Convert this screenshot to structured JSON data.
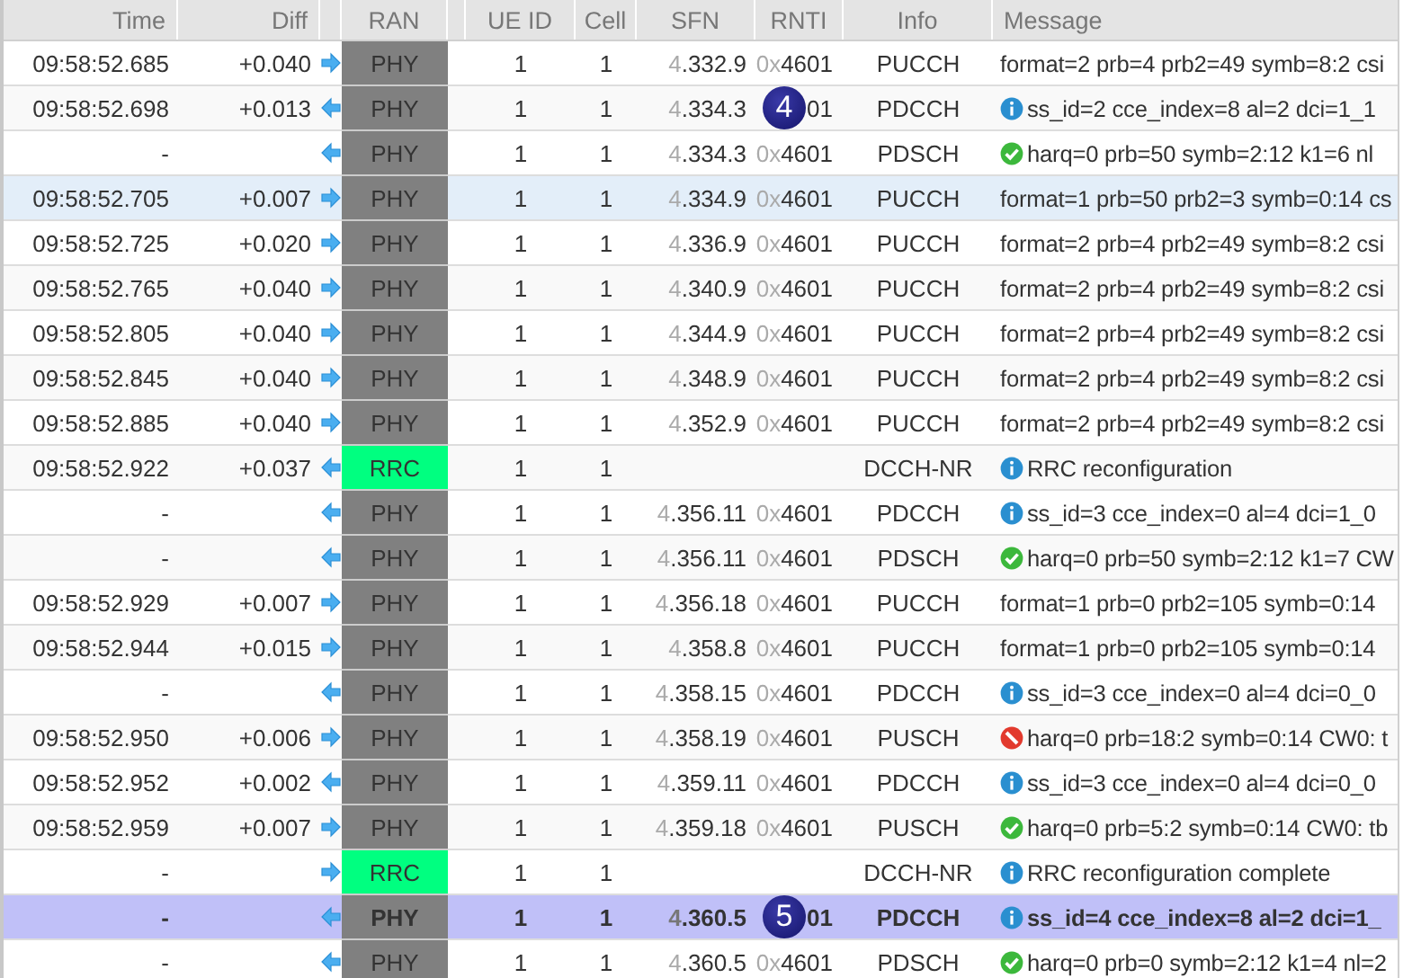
{
  "columns": [
    "Time",
    "Diff",
    "RAN",
    "UE ID",
    "Cell",
    "SFN",
    "RNTI",
    "Info",
    "Message"
  ],
  "rows": [
    {
      "time": "09:58:52.685",
      "diff": "+0.040",
      "arrow": {
        "kind": "right"
      },
      "ran": {
        "text": "PHY",
        "color": "#808080"
      },
      "ue": "1",
      "cell": "1",
      "sfn": {
        "hyper": "4",
        "rest": ".332.9"
      },
      "rnti": {
        "prefix": "0x",
        "value": "4601"
      },
      "info": "PUCCH",
      "message": {
        "kind": "plain",
        "text": "format=2 prb=4 prb2=49 symb=8:2 csi"
      },
      "selected": false,
      "hover": false
    },
    {
      "time": "09:58:52.698",
      "diff": "+0.013",
      "arrow": {
        "kind": "left"
      },
      "ran": {
        "text": "PHY",
        "color": "#808080"
      },
      "ue": "1",
      "cell": "1",
      "sfn": {
        "hyper": "4",
        "rest": ".334.3"
      },
      "rnti": {
        "value": "01"
      },
      "badge": "4",
      "info": "PDCCH",
      "message": {
        "kind": "info",
        "text": "ss_id=2 cce_index=8 al=2 dci=1_1"
      },
      "selected": false,
      "hover": false
    },
    {
      "time": "-",
      "arrow": {
        "kind": "left"
      },
      "ran": {
        "text": "PHY",
        "color": "#808080"
      },
      "ue": "1",
      "cell": "1",
      "sfn": {
        "hyper": "4",
        "rest": ".334.3"
      },
      "rnti": {
        "prefix": "0x",
        "value": "4601"
      },
      "info": "PDSCH",
      "message": {
        "kind": "ok",
        "text": "harq=0 prb=50 symb=2:12 k1=6 nl"
      },
      "selected": false,
      "hover": false
    },
    {
      "time": "09:58:52.705",
      "diff": "+0.007",
      "arrow": {
        "kind": "right"
      },
      "ran": {
        "text": "PHY",
        "color": "#808080"
      },
      "ue": "1",
      "cell": "1",
      "sfn": {
        "hyper": "4",
        "rest": ".334.9"
      },
      "rnti": {
        "prefix": "0x",
        "value": "4601"
      },
      "info": "PUCCH",
      "message": {
        "kind": "plain",
        "text": "format=1 prb=50 prb2=3 symb=0:14 cs"
      },
      "selected": false,
      "hover": true
    },
    {
      "time": "09:58:52.725",
      "diff": "+0.020",
      "arrow": {
        "kind": "right"
      },
      "ran": {
        "text": "PHY",
        "color": "#808080"
      },
      "ue": "1",
      "cell": "1",
      "sfn": {
        "hyper": "4",
        "rest": ".336.9"
      },
      "rnti": {
        "prefix": "0x",
        "value": "4601"
      },
      "info": "PUCCH",
      "message": {
        "kind": "plain",
        "text": "format=2 prb=4 prb2=49 symb=8:2 csi"
      },
      "selected": false,
      "hover": false
    },
    {
      "time": "09:58:52.765",
      "diff": "+0.040",
      "arrow": {
        "kind": "right"
      },
      "ran": {
        "text": "PHY",
        "color": "#808080"
      },
      "ue": "1",
      "cell": "1",
      "sfn": {
        "hyper": "4",
        "rest": ".340.9"
      },
      "rnti": {
        "prefix": "0x",
        "value": "4601"
      },
      "info": "PUCCH",
      "message": {
        "kind": "plain",
        "text": "format=2 prb=4 prb2=49 symb=8:2 csi"
      },
      "selected": false,
      "hover": false
    },
    {
      "time": "09:58:52.805",
      "diff": "+0.040",
      "arrow": {
        "kind": "right"
      },
      "ran": {
        "text": "PHY",
        "color": "#808080"
      },
      "ue": "1",
      "cell": "1",
      "sfn": {
        "hyper": "4",
        "rest": ".344.9"
      },
      "rnti": {
        "prefix": "0x",
        "value": "4601"
      },
      "info": "PUCCH",
      "message": {
        "kind": "plain",
        "text": "format=2 prb=4 prb2=49 symb=8:2 csi"
      },
      "selected": false,
      "hover": false
    },
    {
      "time": "09:58:52.845",
      "diff": "+0.040",
      "arrow": {
        "kind": "right"
      },
      "ran": {
        "text": "PHY",
        "color": "#808080"
      },
      "ue": "1",
      "cell": "1",
      "sfn": {
        "hyper": "4",
        "rest": ".348.9"
      },
      "rnti": {
        "prefix": "0x",
        "value": "4601"
      },
      "info": "PUCCH",
      "message": {
        "kind": "plain",
        "text": "format=2 prb=4 prb2=49 symb=8:2 csi"
      },
      "selected": false,
      "hover": false
    },
    {
      "time": "09:58:52.885",
      "diff": "+0.040",
      "arrow": {
        "kind": "right"
      },
      "ran": {
        "text": "PHY",
        "color": "#808080"
      },
      "ue": "1",
      "cell": "1",
      "sfn": {
        "hyper": "4",
        "rest": ".352.9"
      },
      "rnti": {
        "prefix": "0x",
        "value": "4601"
      },
      "info": "PUCCH",
      "message": {
        "kind": "plain",
        "text": "format=2 prb=4 prb2=49 symb=8:2 csi"
      },
      "selected": false,
      "hover": false
    },
    {
      "time": "09:58:52.922",
      "diff": "+0.037",
      "arrow": {
        "kind": "left"
      },
      "ran": {
        "text": "RRC",
        "color": "#00ff80"
      },
      "ue": "1",
      "cell": "1",
      "info": "DCCH-NR",
      "message": {
        "kind": "info",
        "text": "RRC reconfiguration"
      },
      "selected": false,
      "hover": false
    },
    {
      "time": "-",
      "arrow": {
        "kind": "left"
      },
      "ran": {
        "text": "PHY",
        "color": "#808080"
      },
      "ue": "1",
      "cell": "1",
      "sfn": {
        "hyper": "4",
        "rest": ".356.11"
      },
      "rnti": {
        "prefix": "0x",
        "value": "4601"
      },
      "info": "PDCCH",
      "message": {
        "kind": "info",
        "text": "ss_id=3 cce_index=0 al=4 dci=1_0"
      },
      "selected": false,
      "hover": false
    },
    {
      "time": "-",
      "arrow": {
        "kind": "left"
      },
      "ran": {
        "text": "PHY",
        "color": "#808080"
      },
      "ue": "1",
      "cell": "1",
      "sfn": {
        "hyper": "4",
        "rest": ".356.11"
      },
      "rnti": {
        "prefix": "0x",
        "value": "4601"
      },
      "info": "PDSCH",
      "message": {
        "kind": "ok",
        "text": "harq=0 prb=50 symb=2:12 k1=7 CW"
      },
      "selected": false,
      "hover": false
    },
    {
      "time": "09:58:52.929",
      "diff": "+0.007",
      "arrow": {
        "kind": "right"
      },
      "ran": {
        "text": "PHY",
        "color": "#808080"
      },
      "ue": "1",
      "cell": "1",
      "sfn": {
        "hyper": "4",
        "rest": ".356.18"
      },
      "rnti": {
        "prefix": "0x",
        "value": "4601"
      },
      "info": "PUCCH",
      "message": {
        "kind": "plain",
        "text": "format=1 prb=0 prb2=105 symb=0:14"
      },
      "selected": false,
      "hover": false
    },
    {
      "time": "09:58:52.944",
      "diff": "+0.015",
      "arrow": {
        "kind": "right"
      },
      "ran": {
        "text": "PHY",
        "color": "#808080"
      },
      "ue": "1",
      "cell": "1",
      "sfn": {
        "hyper": "4",
        "rest": ".358.8"
      },
      "rnti": {
        "prefix": "0x",
        "value": "4601"
      },
      "info": "PUCCH",
      "message": {
        "kind": "plain",
        "text": "format=1 prb=0 prb2=105 symb=0:14"
      },
      "selected": false,
      "hover": false
    },
    {
      "time": "-",
      "arrow": {
        "kind": "left"
      },
      "ran": {
        "text": "PHY",
        "color": "#808080"
      },
      "ue": "1",
      "cell": "1",
      "sfn": {
        "hyper": "4",
        "rest": ".358.15"
      },
      "rnti": {
        "prefix": "0x",
        "value": "4601"
      },
      "info": "PDCCH",
      "message": {
        "kind": "info",
        "text": "ss_id=3 cce_index=0 al=4 dci=0_0"
      },
      "selected": false,
      "hover": false
    },
    {
      "time": "09:58:52.950",
      "diff": "+0.006",
      "arrow": {
        "kind": "right"
      },
      "ran": {
        "text": "PHY",
        "color": "#808080"
      },
      "ue": "1",
      "cell": "1",
      "sfn": {
        "hyper": "4",
        "rest": ".358.19"
      },
      "rnti": {
        "prefix": "0x",
        "value": "4601"
      },
      "info": "PUSCH",
      "message": {
        "kind": "error",
        "text": "harq=0 prb=18:2 symb=0:14 CW0: t"
      },
      "selected": false,
      "hover": false
    },
    {
      "time": "09:58:52.952",
      "diff": "+0.002",
      "arrow": {
        "kind": "left"
      },
      "ran": {
        "text": "PHY",
        "color": "#808080"
      },
      "ue": "1",
      "cell": "1",
      "sfn": {
        "hyper": "4",
        "rest": ".359.11"
      },
      "rnti": {
        "prefix": "0x",
        "value": "4601"
      },
      "info": "PDCCH",
      "message": {
        "kind": "info",
        "text": "ss_id=3 cce_index=0 al=4 dci=0_0"
      },
      "selected": false,
      "hover": false
    },
    {
      "time": "09:58:52.959",
      "diff": "+0.007",
      "arrow": {
        "kind": "right"
      },
      "ran": {
        "text": "PHY",
        "color": "#808080"
      },
      "ue": "1",
      "cell": "1",
      "sfn": {
        "hyper": "4",
        "rest": ".359.18"
      },
      "rnti": {
        "prefix": "0x",
        "value": "4601"
      },
      "info": "PUSCH",
      "message": {
        "kind": "ok",
        "text": "harq=0 prb=5:2 symb=0:14 CW0: tb"
      },
      "selected": false,
      "hover": false
    },
    {
      "time": "-",
      "arrow": {
        "kind": "right"
      },
      "ran": {
        "text": "RRC",
        "color": "#00ff80"
      },
      "ue": "1",
      "cell": "1",
      "info": "DCCH-NR",
      "message": {
        "kind": "info",
        "text": "RRC reconfiguration complete"
      },
      "selected": false,
      "hover": false
    },
    {
      "time": "-",
      "arrow": {
        "kind": "left"
      },
      "ran": {
        "text": "PHY",
        "color": "#808080"
      },
      "ue": "1",
      "cell": "1",
      "sfn": {
        "hyper": "4",
        "rest": ".360.5"
      },
      "rnti": {
        "value": "01"
      },
      "badge": "5",
      "info": "PDCCH",
      "message": {
        "kind": "info",
        "text": "ss_id=4 cce_index=8 al=2 dci=1_"
      },
      "selected": true,
      "hover": false
    },
    {
      "time": "-",
      "arrow": {
        "kind": "left"
      },
      "ran": {
        "text": "PHY",
        "color": "#808080"
      },
      "ue": "1",
      "cell": "1",
      "sfn": {
        "hyper": "4",
        "rest": ".360.5"
      },
      "rnti": {
        "prefix": "0x",
        "value": "4601"
      },
      "info": "PDSCH",
      "message": {
        "kind": "ok",
        "text": "harq=0 prb=0 symb=2:12 k1=4 nl=2"
      },
      "selected": false,
      "hover": false
    }
  ]
}
